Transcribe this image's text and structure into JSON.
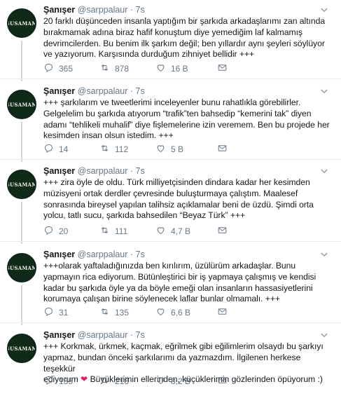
{
  "tweets": [
    {
      "name": "Şanışer",
      "handle": "@sarppalaur",
      "time": "7s",
      "lines": [
        "20 farklı düşünceden insanla yaptığım bir şarkıda arkadaşlarımı zan altında",
        "bırakmamak adına biraz hafif konuştum diye yemediğim laf kalmamış",
        "devrimcilerden. Bu benim ilk şarkım değil; ben yıllardır aynı şeyleri söylüyor",
        "ve yazıyorum. Karşısında durduğum zihniyet bellidir +++"
      ],
      "replies": "365",
      "retweets": "878",
      "likes": "16 B"
    },
    {
      "name": "Şanışer",
      "handle": "@sarppalaur",
      "time": "7s",
      "lines": [
        "+++ şarkılarım ve tweetlerimi inceleyenler bunu rahatlıkla görebilirler.",
        "Gelgelelim bu şarkıda atıyorum “trafik”ten bahsedip “kemerini tak” diyen",
        "adamı “tehlikeli muhalif” diye fişlemelerine izin veremem. Ben bu projede her",
        "kesimden insan olsun istedim. +++"
      ],
      "replies": "14",
      "retweets": "112",
      "likes": "5 B"
    },
    {
      "name": "Şanışer",
      "handle": "@sarppalaur",
      "time": "7s",
      "lines": [
        "+++ zira öyle de oldu. Türk milliyetçisinden dindara kadar her kesimden",
        "müzisyeni ortak derdler çevresinde buluşturmaya çalıştım. Maalesef",
        "sonrasında bireysel yapılan talihsiz açıklamalar beni de üzdü. Şimdi orta",
        "yolcu, tatlı sucu, şarkıda bahsedilen “Beyaz Türk” +++"
      ],
      "replies": "20",
      "retweets": "111",
      "likes": "4,7 B"
    },
    {
      "name": "Şanışer",
      "handle": "@sarppalaur",
      "time": "7s",
      "lines": [
        "+++olarak yaftaladığınızda ben kırılırım, üzülürüm arkadaşlar. Bunu",
        "yapmayın rica ediyorum. Bütünleştirici bir iş yapmaya çalışmış ve kendisi",
        "kadar bu şarkıda öyle ya da böyle emeği olan insanların hassasiyetlerini",
        "korumaya çalışan birine söylenecek laflar bunlar olmamalı. +++"
      ],
      "replies": "31",
      "retweets": "135",
      "likes": "6,6 B"
    },
    {
      "name": "Şanışer",
      "handle": "@sarppalaur",
      "time": "7s",
      "lines": [
        "+++ Korkmak, ürkmek, kaçmak, eğrilmek gibi eğilimlerim olsaydı bu şarkıyı",
        "yapmaz, bundan önceki şarkılarımı da yazmazdım. İlgilenen herkese teşekkür",
        "ediyorum",
        "Büyüklerimin ellerinden, küçüklerimin gözlerinden öpüyorum :)"
      ],
      "replies": "135",
      "retweets": "218",
      "likes": "8,2 B"
    }
  ],
  "avatar_text": "ŞUSAMAM",
  "icons": {
    "reply": "reply-icon",
    "retweet": "retweet-icon",
    "like": "heart-icon",
    "dm": "mail-icon",
    "menu": "chevron-down-icon",
    "emoji": "red-heart-emoji"
  },
  "colors": {
    "text": "#14171a",
    "muted": "#657786",
    "line": "#ccd6dd",
    "heart_emoji": "#e0245e"
  }
}
